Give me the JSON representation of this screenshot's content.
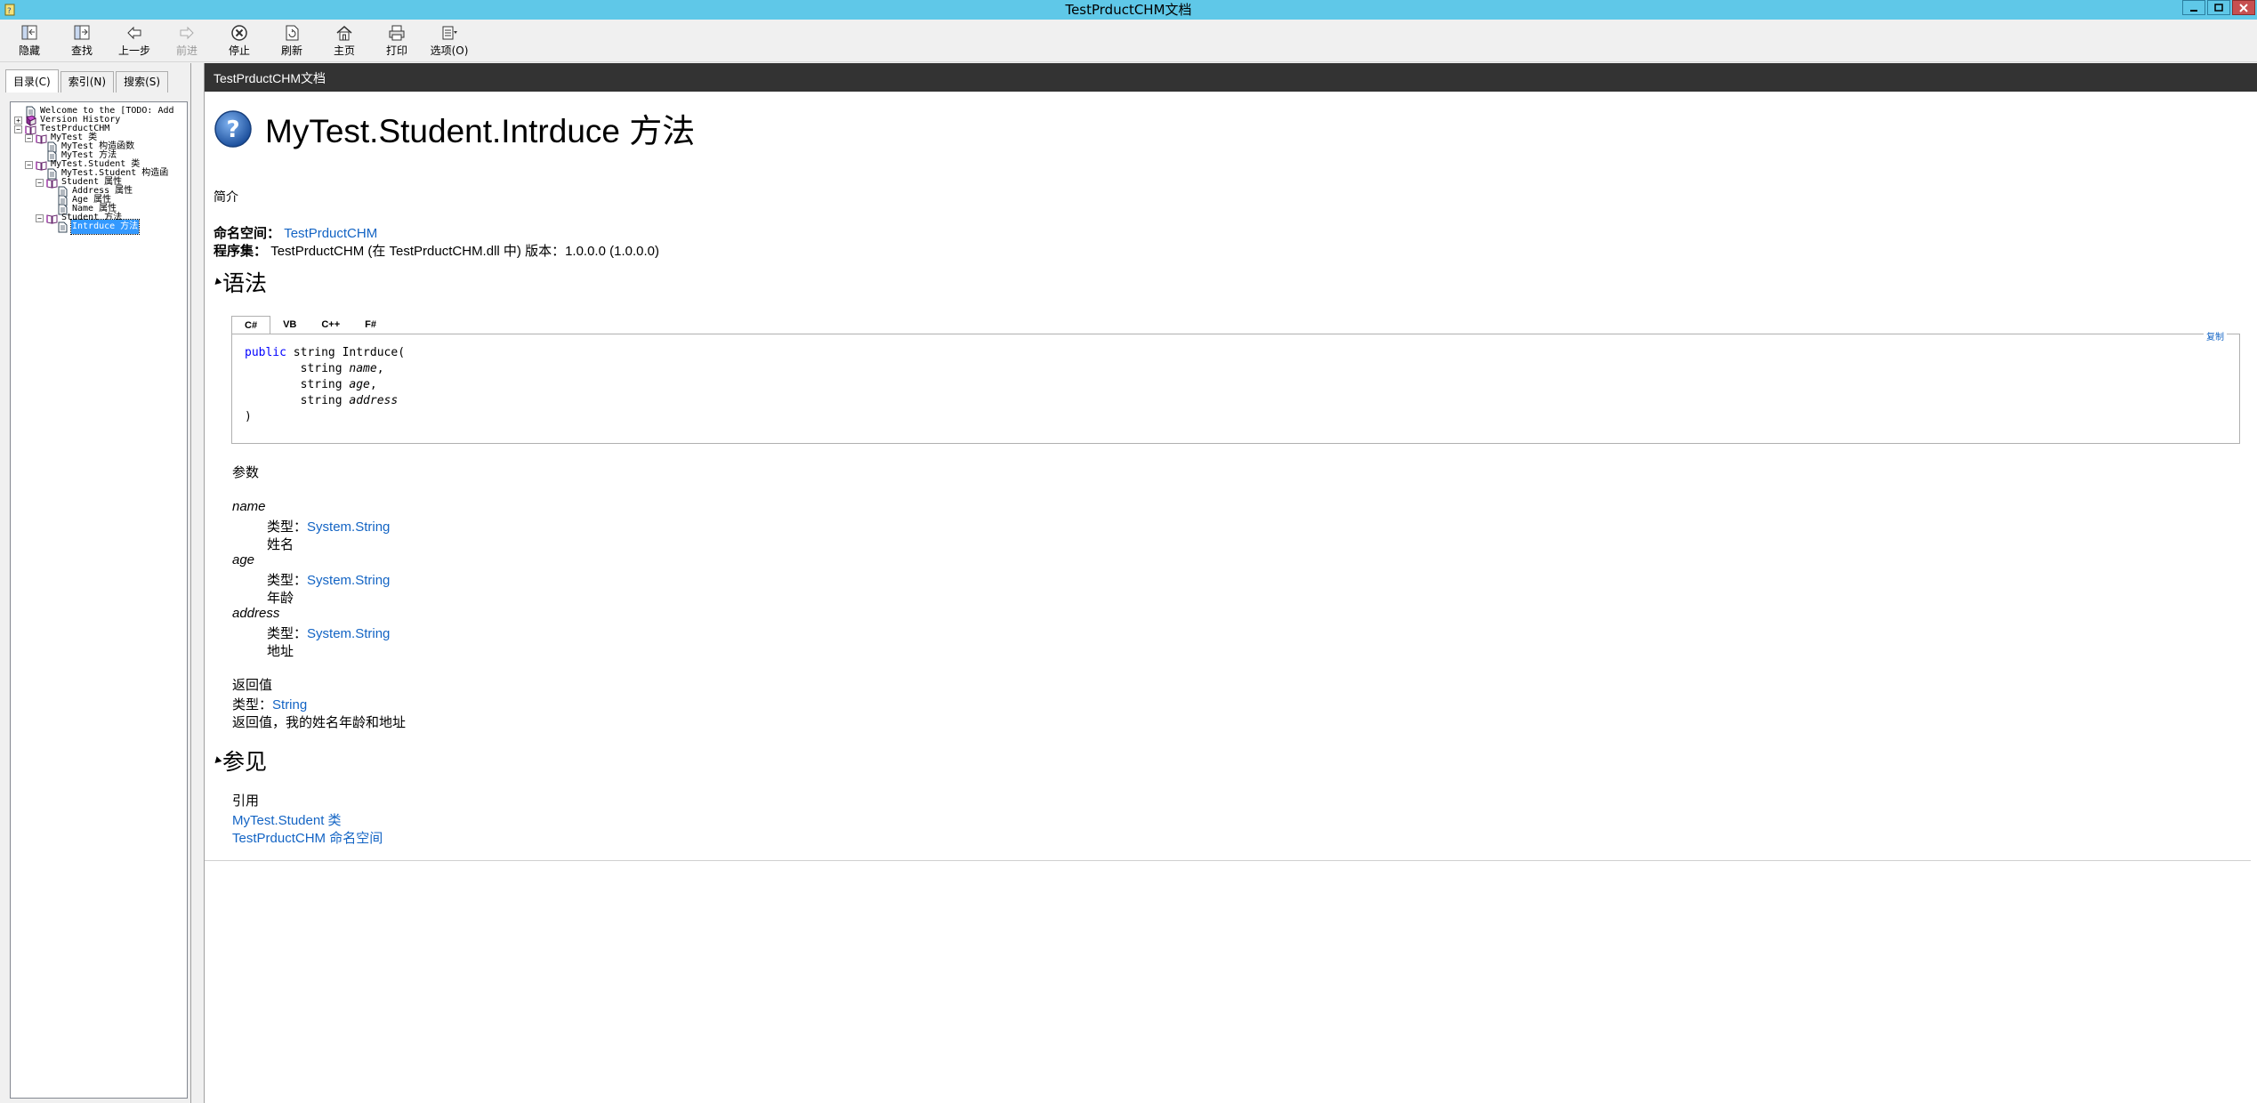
{
  "window": {
    "title": "TestPrductCHM文档"
  },
  "toolbar": {
    "buttons": [
      {
        "label": "隐藏",
        "icon": "hide-icon"
      },
      {
        "label": "查找",
        "icon": "locate-icon"
      },
      {
        "label": "上一步",
        "icon": "back-arrow-icon"
      },
      {
        "label": "前进",
        "icon": "forward-arrow-icon",
        "disabled": true
      },
      {
        "label": "停止",
        "icon": "stop-icon"
      },
      {
        "label": "刷新",
        "icon": "refresh-icon"
      },
      {
        "label": "主页",
        "icon": "home-icon"
      },
      {
        "label": "打印",
        "icon": "print-icon"
      },
      {
        "label": "选项(O)",
        "icon": "options-icon"
      }
    ]
  },
  "nav_tabs": [
    {
      "label": "目录(C)",
      "active": true
    },
    {
      "label": "索引(N)",
      "active": false
    },
    {
      "label": "搜索(S)",
      "active": false
    }
  ],
  "tree": [
    {
      "label": "Welcome to the [TODO: Add",
      "level": 0,
      "expander": "",
      "icon": "page"
    },
    {
      "label": "Version History",
      "level": 0,
      "expander": "+",
      "icon": "book-purple"
    },
    {
      "label": "TestPrductCHM",
      "level": 0,
      "expander": "−",
      "icon": "book-open"
    },
    {
      "label": "MyTest 类",
      "level": 1,
      "expander": "−",
      "icon": "book-open"
    },
    {
      "label": "MyTest 构造函数",
      "level": 2,
      "expander": "",
      "icon": "page"
    },
    {
      "label": "MyTest 方法",
      "level": 2,
      "expander": "",
      "icon": "page"
    },
    {
      "label": "MyTest.Student 类",
      "level": 1,
      "expander": "−",
      "icon": "book-open"
    },
    {
      "label": "MyTest.Student 构造函",
      "level": 2,
      "expander": "",
      "icon": "page"
    },
    {
      "label": "Student 属性",
      "level": 2,
      "expander": "−",
      "icon": "book-open"
    },
    {
      "label": "Address 属性",
      "level": 3,
      "expander": "",
      "icon": "page"
    },
    {
      "label": "Age 属性",
      "level": 3,
      "expander": "",
      "icon": "page"
    },
    {
      "label": "Name 属性",
      "level": 3,
      "expander": "",
      "icon": "page"
    },
    {
      "label": "Student 方法",
      "level": 2,
      "expander": "−",
      "icon": "book-open"
    },
    {
      "label": "Intrduce 方法",
      "level": 3,
      "expander": "",
      "icon": "page",
      "selected": true
    }
  ],
  "content": {
    "header": "TestPrductCHM文档",
    "title": "MyTest.Student.Intrduce 方法",
    "intro": "简介",
    "namespace_label": "命名空间：",
    "namespace_link": "TestPrductCHM",
    "assembly_label": "程序集：",
    "assembly_value": "TestPrductCHM (在 TestPrductCHM.dll 中) 版本：1.0.0.0 (1.0.0.0)",
    "syntax_heading": "语法",
    "code_tabs": [
      "C#",
      "VB",
      "C++",
      "F#"
    ],
    "copy_label": "复制",
    "code": {
      "kw": "public",
      "line1_rest": " string Intrduce(",
      "indent": "        string ",
      "p1": "name",
      "p2": "age",
      "p3": "address",
      "comma": ",",
      "close": ")"
    },
    "params_heading": "参数",
    "params": [
      {
        "name": "name",
        "type_label": "类型：",
        "type_link": "System.String",
        "desc": "姓名"
      },
      {
        "name": "age",
        "type_label": "类型：",
        "type_link": "System.String",
        "desc": "年龄"
      },
      {
        "name": "address",
        "type_label": "类型：",
        "type_link": "System.String",
        "desc": "地址"
      }
    ],
    "return_heading": "返回值",
    "return_type_label": "类型：",
    "return_type_link": "String",
    "return_desc": "返回值，我的姓名年龄和地址",
    "seealso_heading": "参见",
    "ref_heading": "引用",
    "ref_links": [
      "MyTest.Student 类",
      "TestPrductCHM 命名空间"
    ]
  }
}
